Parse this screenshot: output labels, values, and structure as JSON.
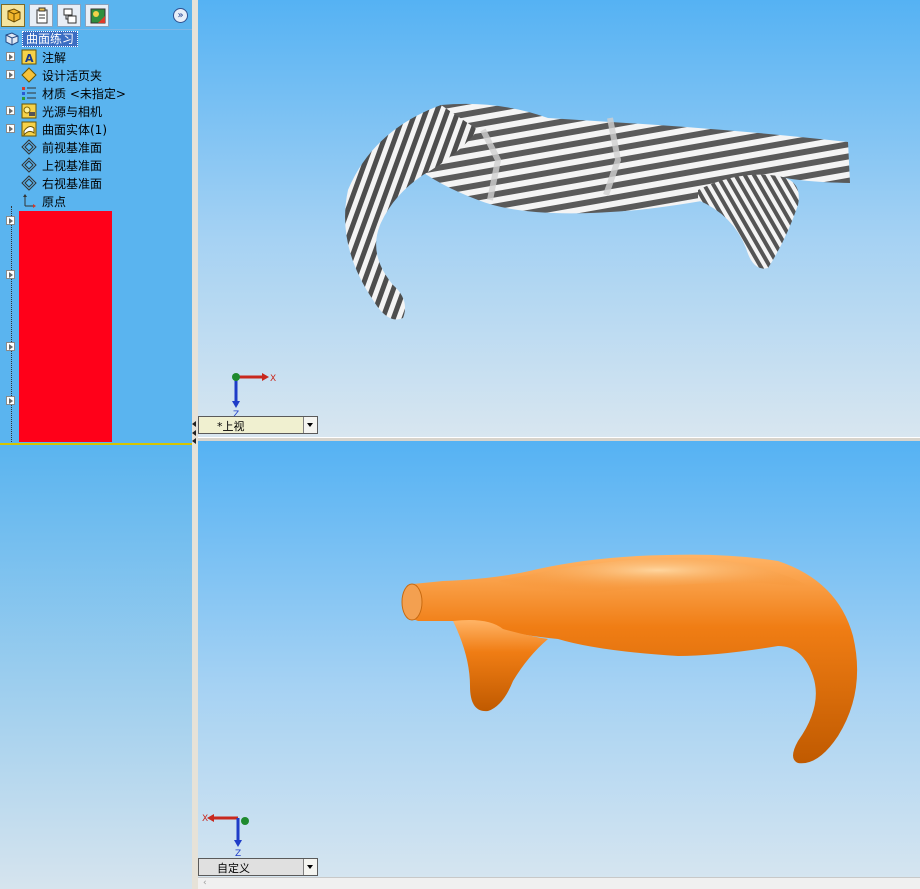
{
  "tree": {
    "root_label": "曲面练习",
    "items": [
      {
        "label": "注解",
        "icon": "annotations-icon",
        "expandable": true
      },
      {
        "label": "设计活页夹",
        "icon": "design-binder-icon",
        "expandable": true
      },
      {
        "label": "材质 <未指定>",
        "icon": "material-icon",
        "expandable": false
      },
      {
        "label": "光源与相机",
        "icon": "lights-cameras-icon",
        "expandable": true
      },
      {
        "label": "曲面实体(1)",
        "icon": "surface-bodies-icon",
        "expandable": true
      },
      {
        "label": "前视基准面",
        "icon": "plane-icon",
        "expandable": false
      },
      {
        "label": "上视基准面",
        "icon": "plane-icon",
        "expandable": false
      },
      {
        "label": "右视基准面",
        "icon": "plane-icon",
        "expandable": false
      },
      {
        "label": "原点",
        "icon": "origin-icon",
        "expandable": false
      }
    ],
    "redacted_color": "#ff0019"
  },
  "toolbar": {
    "tabs": [
      "feature-manager-icon",
      "property-manager-icon",
      "configuration-manager-icon",
      "display-manager-icon"
    ],
    "expand_icon": "double-chevron-right-icon"
  },
  "viewports": {
    "top": {
      "view_name": "*上视",
      "triad": {
        "x": "X",
        "z": "Z"
      },
      "shading": "zebra-stripes"
    },
    "bottom": {
      "view_name": "自定义",
      "triad": {
        "x": "X",
        "z": "Z"
      },
      "shading": "orange"
    }
  },
  "colors": {
    "panel_bg": "#5ab4ef",
    "body_orange": "#f07d14",
    "divider": "#d6c400"
  }
}
